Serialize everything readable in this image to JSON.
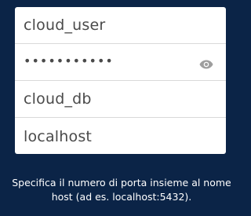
{
  "colors": {
    "background": "#0b2447",
    "card": "#ffffff",
    "text": "#4a4a4a",
    "divider": "#d9d9d9",
    "icon": "#9e9e9e",
    "hint_text": "#ffffff"
  },
  "form": {
    "username": {
      "value": "cloud_user"
    },
    "password": {
      "masked_value": "•••••••••••",
      "toggle_icon": "eye-icon"
    },
    "database": {
      "value": "cloud_db"
    },
    "host": {
      "value": "localhost"
    }
  },
  "hint": {
    "text": "Specifica il numero di porta insieme al nome host (ad es. localhost:5432)."
  }
}
